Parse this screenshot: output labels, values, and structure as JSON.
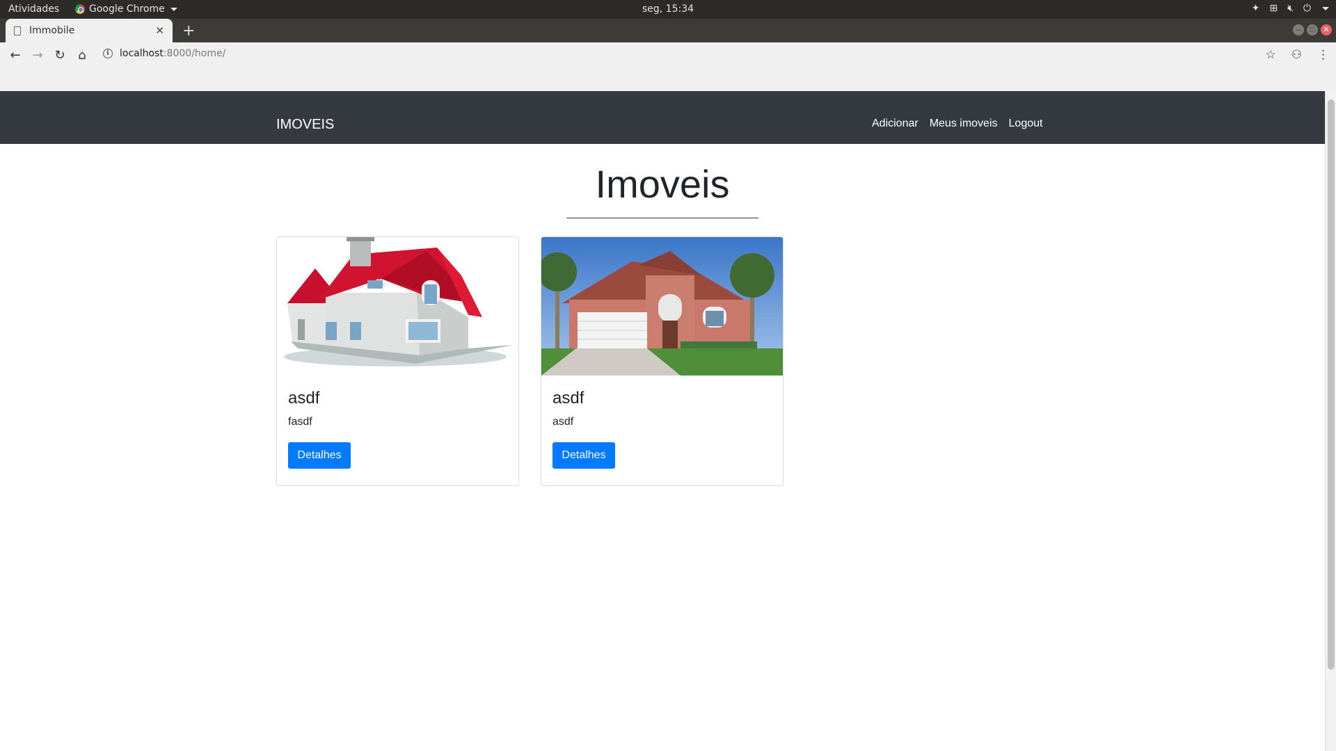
{
  "os": {
    "activities": "Atividades",
    "app_name": "Google Chrome",
    "clock": "seg, 15:34"
  },
  "browser": {
    "tab_title": "Immobile",
    "url_host": "localhost",
    "url_rest": ":8000/home/"
  },
  "site": {
    "brand": "IMOVEIS",
    "nav": [
      "Adicionar",
      "Meus imoveis",
      "Logout"
    ],
    "heading": "Imoveis"
  },
  "cards": [
    {
      "title": "asdf",
      "text": "fasdf",
      "button": "Detalhes",
      "image": "red-roof-house-illustration"
    },
    {
      "title": "asdf",
      "text": "asdf",
      "button": "Detalhes",
      "image": "suburban-house-photo"
    }
  ],
  "colors": {
    "navbar": "#343a40",
    "primary": "#007bff"
  }
}
